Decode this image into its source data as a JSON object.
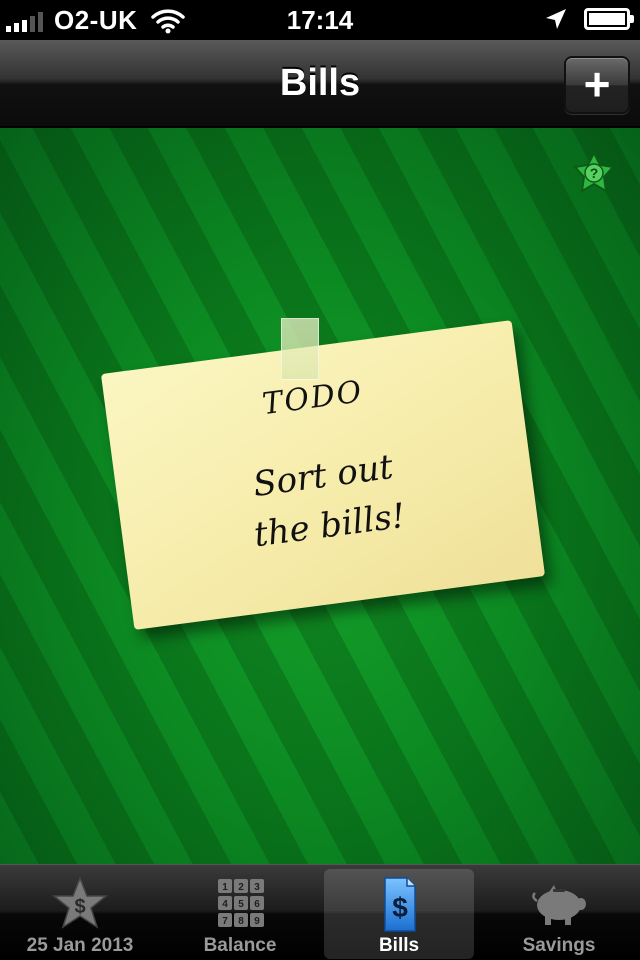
{
  "status_bar": {
    "carrier": "O2-UK",
    "time": "17:14",
    "battery_level": 1.0
  },
  "nav": {
    "title": "Bills",
    "add_label": "+"
  },
  "note": {
    "heading": "TODO",
    "line1": "Sort out",
    "line2": "the bills!"
  },
  "tabs": [
    {
      "label": "25 Jan 2013",
      "icon": "star-dollar-icon",
      "active": false
    },
    {
      "label": "Balance",
      "icon": "keypad-icon",
      "active": false,
      "keys": [
        "1",
        "2",
        "3",
        "4",
        "5",
        "6",
        "7",
        "8",
        "9"
      ]
    },
    {
      "label": "Bills",
      "icon": "bill-dollar-icon",
      "active": true,
      "symbol": "$"
    },
    {
      "label": "Savings",
      "icon": "piggy-bank-icon",
      "active": false
    }
  ],
  "colors": {
    "background_green": "#0c8a22",
    "note_yellow": "#f6ecaa",
    "active_tab_blue": "#2a86e0"
  }
}
